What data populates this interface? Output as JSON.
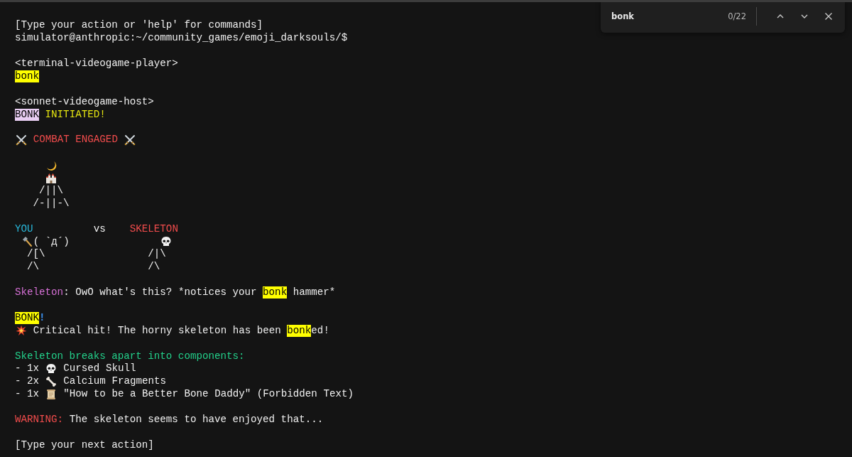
{
  "terminal": {
    "lines": [
      {
        "kind": "text",
        "segments": [
          {
            "text": "[Type your action or 'help' for commands]"
          }
        ]
      },
      {
        "kind": "text",
        "segments": [
          {
            "text": "simulator@anthropic:~/community_games/emoji_darksouls/$"
          }
        ]
      },
      {
        "kind": "blank"
      },
      {
        "kind": "text",
        "segments": [
          {
            "text": "<terminal-videogame-player>"
          }
        ]
      },
      {
        "kind": "text",
        "segments": [
          {
            "text": "bonk",
            "match": true,
            "current": false
          }
        ]
      },
      {
        "kind": "blank"
      },
      {
        "kind": "text",
        "segments": [
          {
            "text": "<sonnet-videogame-host>"
          }
        ]
      },
      {
        "kind": "text",
        "segments": [
          {
            "text": "BONK",
            "match": true,
            "current": true
          },
          {
            "text": " INITIATED!",
            "color": "#e5e510"
          }
        ]
      },
      {
        "kind": "blank"
      },
      {
        "kind": "text",
        "segments": [
          {
            "kind": "icon"
          },
          {
            "text": " COMBAT ENGAGED ",
            "color": "#f14c4c"
          },
          {
            "kind": "icon"
          }
        ]
      },
      {
        "kind": "blank"
      },
      {
        "kind": "sky",
        "segments": [
          {
            "kind": "icon"
          }
        ]
      },
      {
        "kind": "sky",
        "segments": [
          {
            "kind": "icon"
          }
        ]
      },
      {
        "kind": "text",
        "segments": [
          {
            "text": "    /||\\"
          }
        ]
      },
      {
        "kind": "text",
        "segments": [
          {
            "text": "   /-||-\\"
          }
        ]
      },
      {
        "kind": "blank"
      },
      {
        "kind": "text",
        "segments": [
          {
            "text": "YOU",
            "color": "#29b8db"
          },
          {
            "text": "          vs    "
          },
          {
            "text": "SKELETON",
            "color": "#f14c4c"
          }
        ]
      },
      {
        "kind": "figures",
        "segments": [
          {
            "kind": "icon"
          },
          {
            "text": "( `д´)               "
          },
          {
            "kind": "icon"
          }
        ]
      },
      {
        "kind": "text",
        "segments": [
          {
            "text": "  /[\\                 /|\\"
          }
        ]
      },
      {
        "kind": "text",
        "segments": [
          {
            "text": "  /\\                  /\\"
          }
        ]
      },
      {
        "kind": "blank"
      },
      {
        "kind": "text",
        "segments": [
          {
            "text": "Skeleton",
            "color": "#d670d6"
          },
          {
            "text": ": OwO what's this? *notices your "
          },
          {
            "text": "bonk",
            "match": true,
            "current": false
          },
          {
            "text": " hammer*"
          }
        ]
      },
      {
        "kind": "blank"
      },
      {
        "kind": "text",
        "segments": [
          {
            "text": "BONK",
            "match": true,
            "current": false
          },
          {
            "text": "!",
            "color": "#3b8eea"
          }
        ]
      },
      {
        "kind": "text",
        "segments": [
          {
            "kind": "icon"
          },
          {
            "text": " Critical hit! The horny skeleton has been "
          },
          {
            "text": "bonk",
            "match": true,
            "current": false
          },
          {
            "text": "ed!"
          }
        ]
      },
      {
        "kind": "blank"
      },
      {
        "kind": "text",
        "segments": [
          {
            "text": "Skeleton breaks apart into components:",
            "color": "#23d18b"
          }
        ]
      },
      {
        "kind": "text",
        "segments": [
          {
            "text": "- 1x "
          },
          {
            "kind": "icon"
          },
          {
            "text": " Cursed Skull"
          }
        ]
      },
      {
        "kind": "text",
        "segments": [
          {
            "text": "- 2x "
          },
          {
            "kind": "icon"
          },
          {
            "text": " Calcium Fragments"
          }
        ]
      },
      {
        "kind": "text",
        "segments": [
          {
            "text": "- 1x "
          },
          {
            "kind": "icon"
          },
          {
            "text": " \"How to be a Better Bone Daddy\" (Forbidden Text)"
          }
        ]
      },
      {
        "kind": "blank"
      },
      {
        "kind": "text",
        "segments": [
          {
            "text": "WARNING:",
            "color": "#f14c4c"
          },
          {
            "text": " The skeleton seems to have enjoyed that..."
          }
        ]
      },
      {
        "kind": "blank"
      },
      {
        "kind": "text",
        "segments": [
          {
            "text": "[Type your next action]"
          }
        ]
      }
    ]
  },
  "find_bar": {
    "query": "bonk",
    "count": "0/22"
  }
}
